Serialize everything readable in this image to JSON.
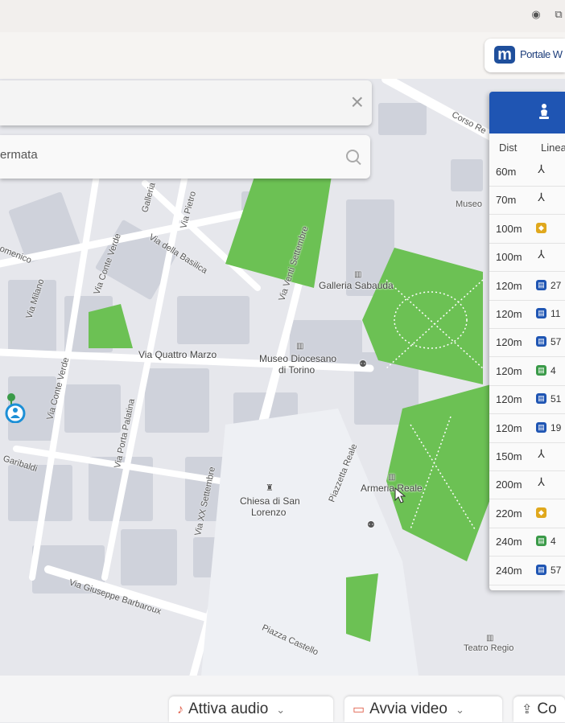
{
  "portal": {
    "label": "Portale W",
    "logo_letter": "m"
  },
  "search": {
    "stop_value": "ermata",
    "close_glyph": "×"
  },
  "stops_panel": {
    "col_dist": "Dist",
    "col_line": "Linea",
    "rows": [
      {
        "dist": "60m",
        "mode": "walk",
        "line": ""
      },
      {
        "dist": "70m",
        "mode": "walk",
        "line": ""
      },
      {
        "dist": "100m",
        "mode": "metro",
        "line": ""
      },
      {
        "dist": "100m",
        "mode": "walk",
        "line": ""
      },
      {
        "dist": "120m",
        "mode": "bus",
        "line": "27"
      },
      {
        "dist": "120m",
        "mode": "bus",
        "line": "11"
      },
      {
        "dist": "120m",
        "mode": "bus",
        "line": "57"
      },
      {
        "dist": "120m",
        "mode": "tram",
        "line": "4"
      },
      {
        "dist": "120m",
        "mode": "bus",
        "line": "51"
      },
      {
        "dist": "120m",
        "mode": "bus",
        "line": "19"
      },
      {
        "dist": "150m",
        "mode": "walk",
        "line": ""
      },
      {
        "dist": "200m",
        "mode": "walk",
        "line": ""
      },
      {
        "dist": "220m",
        "mode": "metro",
        "line": ""
      },
      {
        "dist": "240m",
        "mode": "tram",
        "line": "4"
      },
      {
        "dist": "240m",
        "mode": "bus",
        "line": "57"
      }
    ]
  },
  "map_labels": {
    "via_della_basilica": "Via della Basilica",
    "via_conte_verde": "Via Conte Verde",
    "via_conte_verde_2": "Via Conte Verde",
    "galleria": "Galleria",
    "via_pietro": "Via Pietro",
    "via_venti_settembre": "Via Venti Settembre",
    "galleria_sabauda": "Galleria Sabauda",
    "museo": "Museo",
    "corso_re": "Corso Re",
    "domenico": "omenico",
    "via_milano": "Via Milano",
    "via_quattro_marzo": "Via Quattro Marzo",
    "museo_diocesano_1": "Museo Diocesano",
    "museo_diocesano_2": "di Torino",
    "via_porta_palatina": "Via Porta Palatina",
    "garibaldi": "Garibaldi",
    "via_xx_settembre": "Via XX Settembre",
    "chiesa_1": "Chiesa di San",
    "chiesa_2": "Lorenzo",
    "piazzetta_reale": "Piazzetta Reale",
    "armeria_reale": "Armeria Reale",
    "via_giuseppe_barbaroux": "Via Giuseppe Barbaroux",
    "piazza_castello": "Piazza Castello",
    "teatro_regio": "Teatro Regio"
  },
  "bottom": {
    "audio_label": "Attiva audio",
    "video_label": "Avvia video",
    "share_label": "Co"
  },
  "colors": {
    "accent_blue": "#1f55b3",
    "park_green": "#6cc154",
    "tram_green": "#3a9a48",
    "metro_yellow": "#e0a81d"
  }
}
